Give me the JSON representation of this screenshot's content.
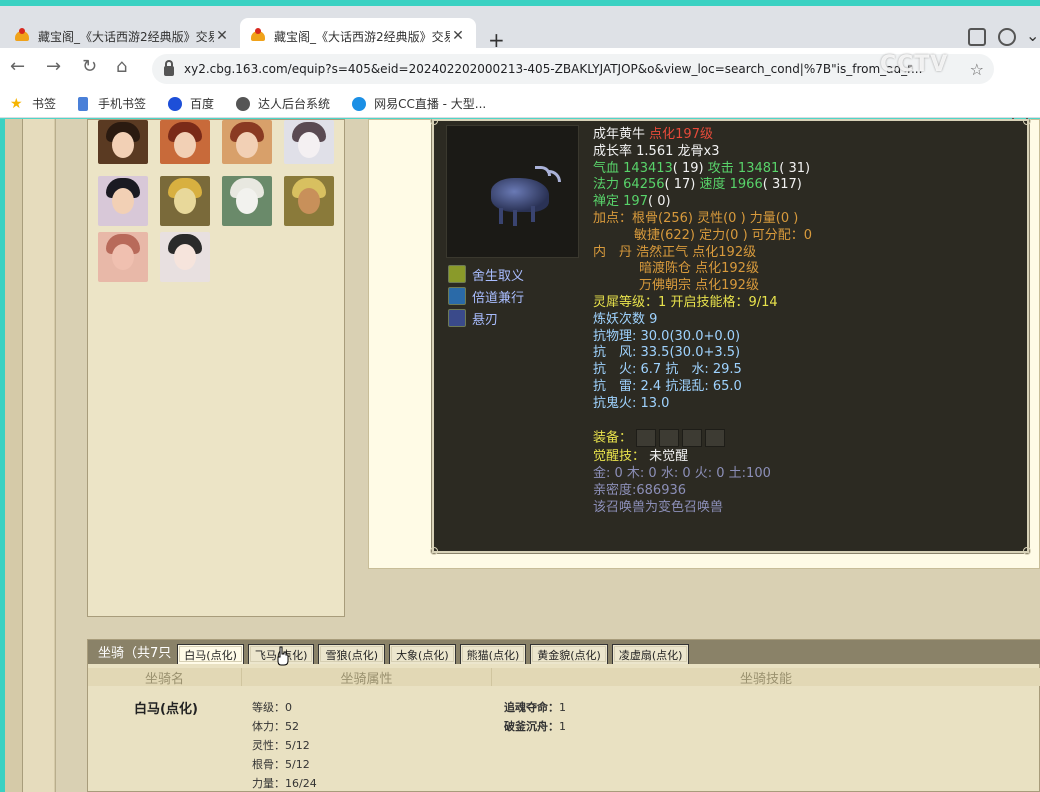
{
  "browser": {
    "tabs": [
      {
        "title": "藏宝阁_《大话西游2经典版》交易"
      },
      {
        "title": "藏宝阁_《大话西游2经典版》交易"
      }
    ],
    "url": "xy2.cbg.163.com/equip?s=405&eid=202402202000213-405-ZBAKLYJATJOP&o&view_loc=search_cond|%7B\"is_from_ad_r...",
    "watermark": "CCTV",
    "bookmarks": [
      {
        "label": "书签",
        "icon": "star-icon"
      },
      {
        "label": "手机书签",
        "icon": "folder-icon"
      },
      {
        "label": "百度",
        "icon": "baidu-paw-icon"
      },
      {
        "label": "达人后台系统",
        "icon": "e-logo-icon"
      },
      {
        "label": "网易CC直播 - 大型...",
        "icon": "cc-logo-icon"
      }
    ]
  },
  "pet": {
    "skills": [
      {
        "name": "舍生取义",
        "icon": "skill-sacrifice-icon",
        "color": "#c8d84a"
      },
      {
        "name": "倍道兼行",
        "icon": "skill-speed-icon",
        "color": "#5aa8e6"
      },
      {
        "name": "悬刃",
        "icon": "skill-blade-icon",
        "color": "#6a78c8"
      }
    ],
    "name_line": {
      "name": "成年黄牛",
      "level": "点化197级"
    },
    "growth_line": {
      "label": "成长率",
      "value": "1.561",
      "extra": "龙骨x3"
    },
    "hp_line": {
      "hp_label": "气血",
      "hp": "143413",
      "hp_pts": "( 19)",
      "atk_label": "攻击",
      "atk": "13481",
      "atk_pts": "( 31)"
    },
    "mp_line": {
      "mp_label": "法力",
      "mp": "64256",
      "mp_pts": "( 17)",
      "spd_label": "速度",
      "spd": "1966",
      "spd_pts": "( 317)"
    },
    "calm_line": {
      "label": "禅定",
      "value": "197",
      "pts": "( 0)"
    },
    "alloc_line1": "加点：根骨(256) 灵性(0 ) 力量(0 )",
    "alloc_line2": "敏捷(622) 定力(0 ) 可分配：0",
    "neidan": {
      "label": "内　丹",
      "items": [
        "浩然正气 点化192级",
        "暗渡陈仓 点化192级",
        "万佛朝宗 点化192级"
      ]
    },
    "lingxi_line": {
      "label": "灵犀等级：",
      "level": "1",
      "slots_label": "开启技能格：",
      "slots": "9/14"
    },
    "lianyao_line": {
      "label": "炼妖次数",
      "value": "9"
    },
    "resist": [
      "抗物理: 30.0(30.0+0.0)",
      "抗　风: 33.5(30.0+3.5)",
      "抗　火: 6.7 抗　水: 29.5",
      "抗　雷: 2.4 抗混乱: 65.0",
      "抗鬼火: 13.0"
    ],
    "equip_label": "装备：",
    "awaken": {
      "label": "觉醒技：",
      "value": "未觉醒"
    },
    "elements": "金: 0 木: 0 水: 0 火: 0 土:100",
    "intimacy": "亲密度:686936",
    "variant_note": "该召唤兽为变色召唤兽"
  },
  "mounts": {
    "title": "坐骑（共7只",
    "tabs": [
      "白马(点化)",
      "飞马(点化)",
      "雪狼(点化)",
      "大象(点化)",
      "熊猫(点化)",
      "黄金貌(点化)",
      "凌虚扇(点化)"
    ],
    "headers": [
      "坐骑名",
      "坐骑属性",
      "坐骑技能"
    ],
    "selected": {
      "name": "白马(点化)",
      "attrs": [
        "等级：0",
        "体力：52",
        "灵性：5/12",
        "根骨：5/12",
        "力量：16/24"
      ],
      "skills": [
        {
          "name": "追魂夺命：",
          "level": "1"
        },
        {
          "name": "破釜沉舟：",
          "level": "1"
        }
      ]
    }
  }
}
